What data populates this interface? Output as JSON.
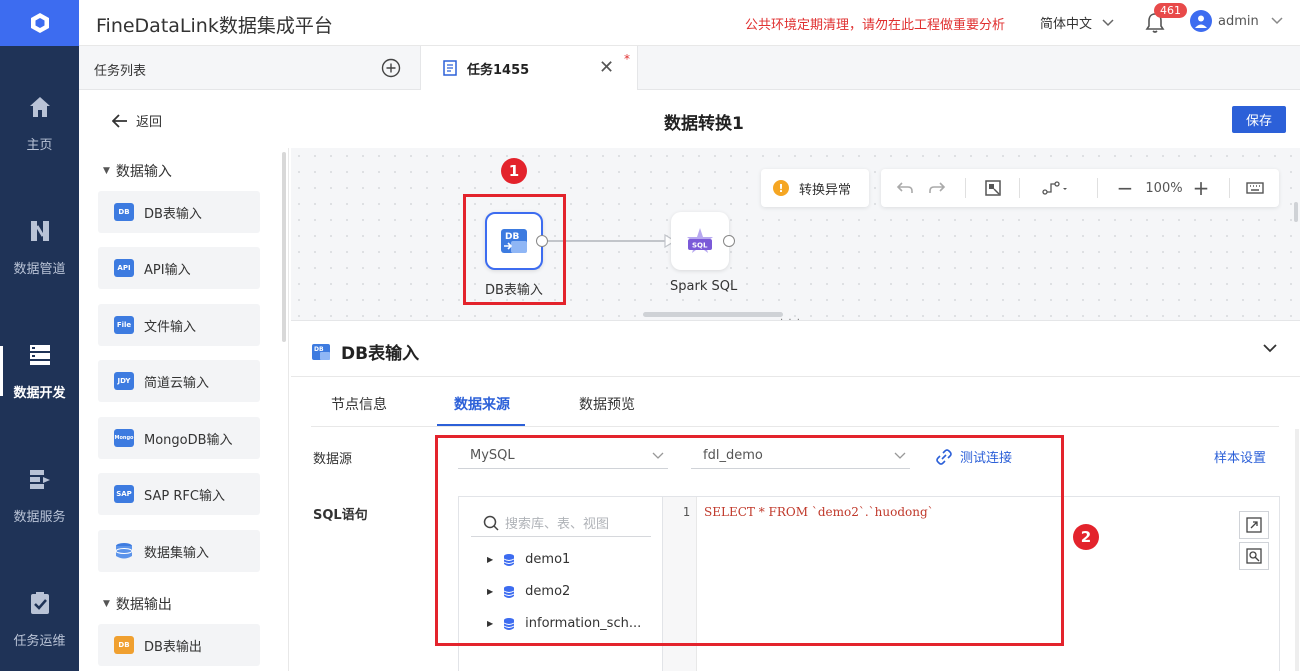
{
  "app": {
    "title": "FineDataLink数据集成平台",
    "notice": "公共环境定期清理，请勿在此工程做重要分析",
    "language": "简体中文",
    "notification_count": "461",
    "user": "admin"
  },
  "nav": {
    "items": [
      {
        "label": "主页"
      },
      {
        "label": "数据管道"
      },
      {
        "label": "数据开发"
      },
      {
        "label": "数据服务"
      },
      {
        "label": "任务运维"
      }
    ],
    "active": "数据开发"
  },
  "tabs": {
    "task_list": "任务列表",
    "active_tab": "任务1455",
    "modified_mark": "*"
  },
  "page": {
    "back_label": "返回",
    "title": "数据转换1",
    "save_label": "保存"
  },
  "components": {
    "input_group": "数据输入",
    "input_items": [
      {
        "label": "DB表输入",
        "icon": "DB"
      },
      {
        "label": "API输入",
        "icon": "API"
      },
      {
        "label": "文件输入",
        "icon": "File"
      },
      {
        "label": "简道云输入",
        "icon": "JDY"
      },
      {
        "label": "MongoDB输入",
        "icon": "Mongo"
      },
      {
        "label": "SAP RFC输入",
        "icon": "SAP"
      },
      {
        "label": "数据集输入",
        "icon": "dataset"
      }
    ],
    "output_group": "数据输出",
    "output_items": [
      {
        "label": "DB表输出",
        "icon": "DB"
      }
    ]
  },
  "canvas": {
    "nodes": [
      {
        "label": "DB表输入",
        "icon": "DB"
      },
      {
        "label": "Spark SQL",
        "icon": "SQL"
      }
    ],
    "warning": "转换异常",
    "zoom": "100%",
    "annotations": [
      "1",
      "2"
    ]
  },
  "panel": {
    "title": "DB表输入",
    "tabs": [
      "节点信息",
      "数据来源",
      "数据预览"
    ],
    "active_tab": "数据来源",
    "datasource_label": "数据源",
    "datasource_type": "MySQL",
    "datasource_db": "fdl_demo",
    "test_connection": "测试连接",
    "sample_settings": "样本设置",
    "sql_label": "SQL语句",
    "search_placeholder": "搜索库、表、视图",
    "tree": [
      "demo1",
      "demo2",
      "information_sch..."
    ],
    "line_number": "1",
    "sql": "SELECT * FROM `demo2`.`huodong`"
  },
  "colors": {
    "nav_bg": "#1f3357",
    "accent": "#2c60d8",
    "annotation": "#e3232c",
    "sql_text": "#c0392b"
  }
}
